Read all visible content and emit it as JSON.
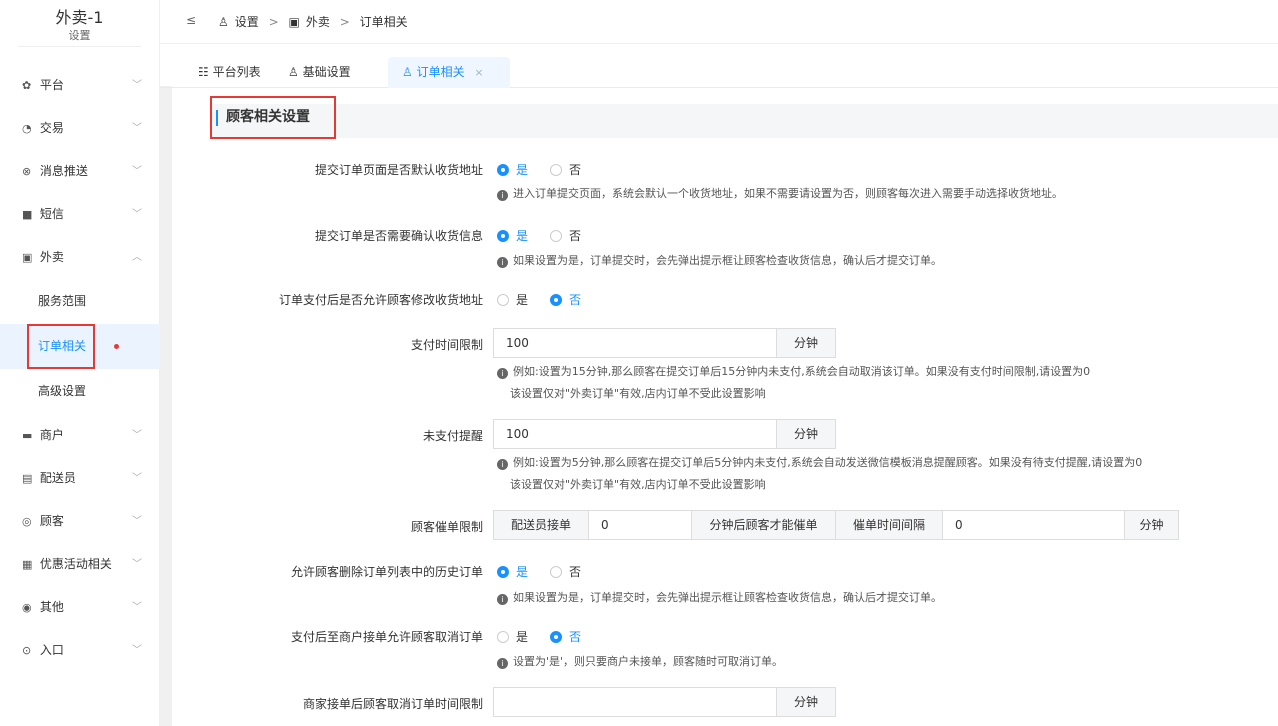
{
  "brand": {
    "title": "外卖-1",
    "subtitle": "设置"
  },
  "sidebar": {
    "items": [
      {
        "label": "平台",
        "icon": "gear-icon"
      },
      {
        "label": "交易",
        "icon": "trade-icon"
      },
      {
        "label": "消息推送",
        "icon": "message-icon"
      },
      {
        "label": "短信",
        "icon": "sms-icon"
      },
      {
        "label": "外卖",
        "icon": "delivery-icon",
        "expanded": true
      },
      {
        "label": "商户",
        "icon": "store-icon"
      },
      {
        "label": "配送员",
        "icon": "courier-icon"
      },
      {
        "label": "顾客",
        "icon": "customer-icon"
      },
      {
        "label": "优惠活动相关",
        "icon": "gift-icon"
      },
      {
        "label": "其他",
        "icon": "other-icon"
      },
      {
        "label": "入口",
        "icon": "entry-icon"
      }
    ],
    "sub_items": [
      "服务范围",
      "订单相关",
      "高级设置"
    ]
  },
  "header": {
    "breadcrumb": [
      "设置",
      "外卖",
      "订单相关"
    ],
    "sep": ">"
  },
  "tabs": [
    {
      "label": "平台列表"
    },
    {
      "label": "基础设置"
    },
    {
      "label": "订单相关",
      "close": "×"
    }
  ],
  "section": {
    "title": "顾客相关设置"
  },
  "form": {
    "yes": "是",
    "no": "否",
    "default_address": {
      "label": "提交订单页面是否默认收货地址",
      "value": "是",
      "hint": "进入订单提交页面，系统会默认一个收货地址，如果不需要请设置为否，则顾客每次进入需要手动选择收货地址。"
    },
    "confirm_address": {
      "label": "提交订单是否需要确认收货信息",
      "value": "是",
      "hint": "如果设置为是，订单提交时，会先弹出提示框让顾客检查收货信息，确认后才提交订单。"
    },
    "modify_address": {
      "label": "订单支付后是否允许顾客修改收货地址",
      "value": "否"
    },
    "pay_limit": {
      "label": "支付时间限制",
      "value": "100",
      "unit": "分钟",
      "hint1": "例如:设置为15分钟,那么顾客在提交订单后15分钟内未支付,系统会自动取消该订单。如果没有支付时间限制,请设置为0",
      "hint2": "该设置仅对\"外卖订单\"有效,店内订单不受此设置影响"
    },
    "unpaid_remind": {
      "label": "未支付提醒",
      "value": "100",
      "unit": "分钟",
      "hint1": "例如:设置为5分钟,那么顾客在提交订单后5分钟内未支付,系统会自动发送微信模板消息提醒顾客。如果没有待支付提醒,请设置为0",
      "hint2": "该设置仅对\"外卖订单\"有效,店内订单不受此设置影响"
    },
    "urge_limit": {
      "label": "顾客催单限制",
      "prefix": "配送员接单",
      "value1": "0",
      "middle": "分钟后顾客才能催单",
      "interval_label": "催单时间间隔",
      "value2": "0",
      "unit": "分钟"
    },
    "delete_history": {
      "label": "允许顾客删除订单列表中的历史订单",
      "value": "是",
      "hint": "如果设置为是，订单提交时，会先弹出提示框让顾客检查收货信息，确认后才提交订单。"
    },
    "cancel_before_accept": {
      "label": "支付后至商户接单允许顾客取消订单",
      "value": "否",
      "hint": "设置为'是'，则只要商户未接单，顾客随时可取消订单。"
    },
    "cancel_after_accept": {
      "label": "商家接单后顾客取消订单时间限制",
      "value": "",
      "unit": "分钟"
    }
  }
}
